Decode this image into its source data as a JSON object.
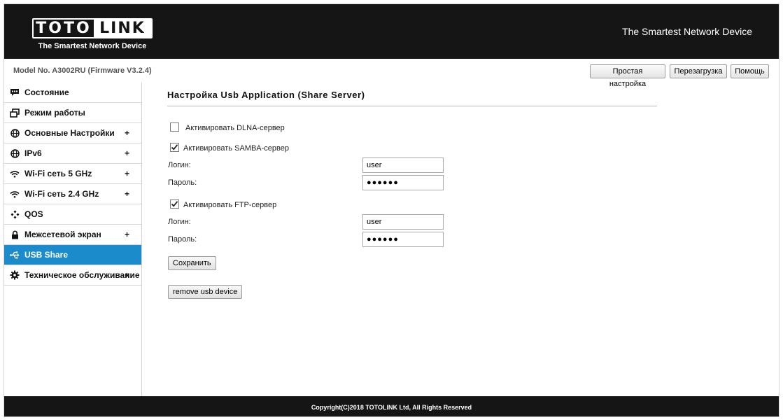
{
  "header": {
    "logo_left": "TOTO",
    "logo_right": "LINK",
    "logo_tagline": "The Smartest Network Device",
    "slogan": "The Smartest Network Device"
  },
  "topbar": {
    "model": "Model No. A3002RU (Firmware V3.2.4)",
    "quick_setup": "Простая настройка",
    "reboot": "Перезагрузка",
    "help": "Помощь"
  },
  "sidebar": {
    "items": [
      {
        "label": "Состояние",
        "icon": "chat-bubble-icon",
        "expandable": ""
      },
      {
        "label": "Режим работы",
        "icon": "windows-icon",
        "expandable": ""
      },
      {
        "label": "Основные Настройки",
        "icon": "globe-icon",
        "expandable": "+"
      },
      {
        "label": "IPv6",
        "icon": "globe-icon",
        "expandable": "+"
      },
      {
        "label": "Wi-Fi сеть 5 GHz",
        "icon": "wifi-icon",
        "expandable": "+"
      },
      {
        "label": "Wi-Fi сеть 2.4 GHz",
        "icon": "wifi-icon",
        "expandable": "+"
      },
      {
        "label": "QOS",
        "icon": "qos-icon",
        "expandable": ""
      },
      {
        "label": "Межсетевой экран",
        "icon": "lock-icon",
        "expandable": "+"
      },
      {
        "label": "USB Share",
        "icon": "usb-icon",
        "expandable": "",
        "active": true
      },
      {
        "label": "Техническое обслуживание",
        "icon": "gear-icon",
        "expandable": "+"
      }
    ],
    "active_color": "#1c8bcc"
  },
  "main": {
    "title": "Настройка Usb Application (Share Server)",
    "dlna": {
      "label": "Активировать DLNA-сервер",
      "checked": false
    },
    "samba": {
      "label": "Активировать SAMBA-сервер",
      "checked": true,
      "login_label": "Логин:",
      "login_value": "user",
      "password_label": "Пароль:",
      "password_value": "●●●●●●"
    },
    "ftp": {
      "label": "Активировать FTP-сервер",
      "checked": true,
      "login_label": "Логин:",
      "login_value": "user",
      "password_label": "Пароль:",
      "password_value": "●●●●●●"
    },
    "save_label": "Сохранить",
    "remove_label": "remove usb device"
  },
  "footer": {
    "copyright": "Copyright(C)2018 TOTOLINK Ltd, All Rights Reserved"
  }
}
